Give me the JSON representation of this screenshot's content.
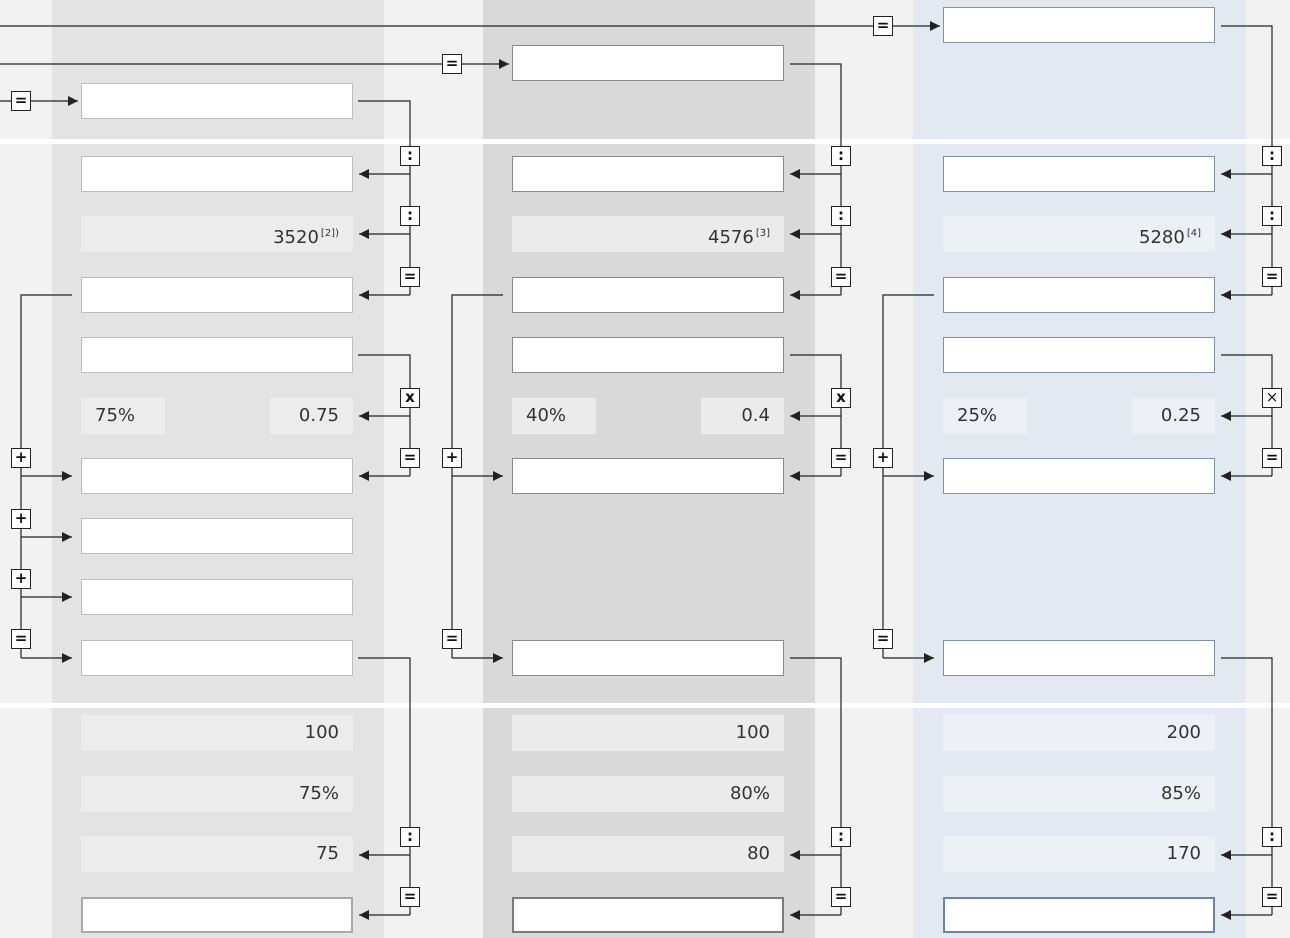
{
  "columns": [
    {
      "id": "col1",
      "ref_value": "3520",
      "ref_note": "[2])",
      "pct_label": "75%",
      "decimal": "0.75",
      "bottom": {
        "base": "100",
        "rate": "75%",
        "result": "75"
      }
    },
    {
      "id": "col2",
      "ref_value": "4576",
      "ref_note": "[3]",
      "pct_label": "40%",
      "decimal": "0.4",
      "bottom": {
        "base": "100",
        "rate": "80%",
        "result": "80"
      }
    },
    {
      "id": "col3",
      "ref_value": "5280",
      "ref_note": "[4]",
      "pct_label": "25%",
      "decimal": "0.25",
      "bottom": {
        "base": "200",
        "rate": "85%",
        "result": "170"
      }
    }
  ],
  "operators": {
    "equals": "=",
    "divide": ":",
    "multiply": "x",
    "multiply_alt": "×",
    "plus": "+"
  },
  "colors": {
    "band_col1": "#e3e3e3",
    "band_col2": "#d9d9d9",
    "band_col3": "#e4e8f0",
    "background": "#f2f2f2",
    "connector": "#222222"
  }
}
